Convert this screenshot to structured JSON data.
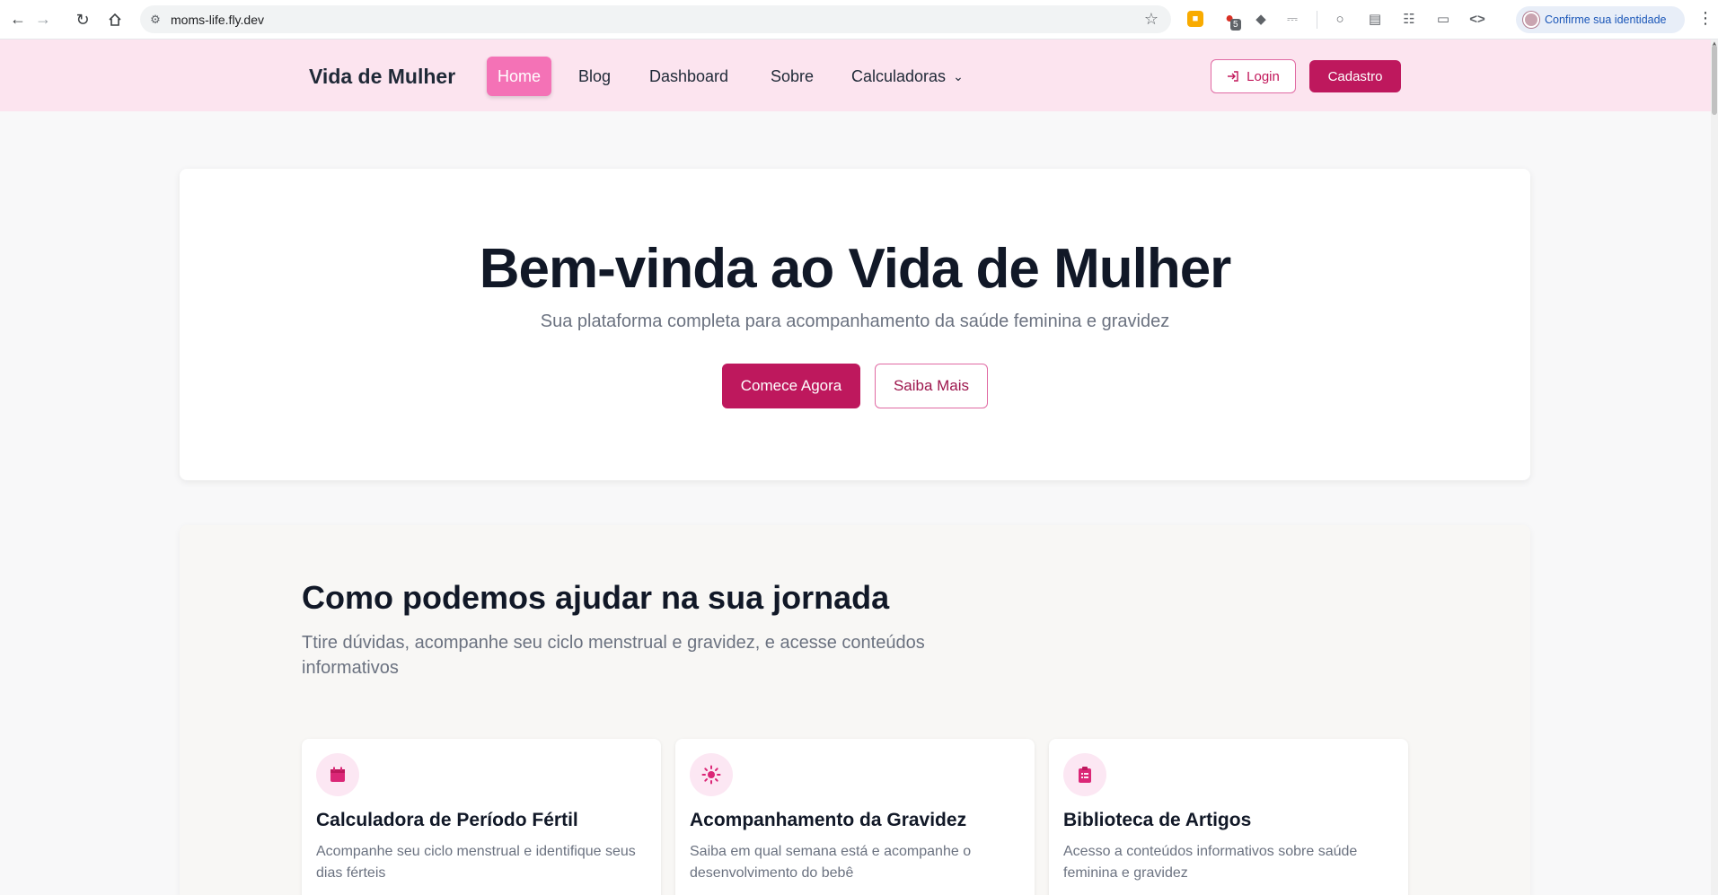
{
  "browser": {
    "url": "moms-life.fly.dev",
    "profile_label": "Confirme sua identidade",
    "extension_badge": "5"
  },
  "navbar": {
    "brand": "Vida de Mulher",
    "links": [
      {
        "label": "Home",
        "active": true
      },
      {
        "label": "Blog"
      },
      {
        "label": "Dashboard"
      },
      {
        "label": "Sobre"
      },
      {
        "label": "Calculadoras"
      }
    ],
    "login_label": "Login",
    "cadastro_label": "Cadastro"
  },
  "hero": {
    "title": "Bem-vinda ao Vida de Mulher",
    "subtitle": "Sua plataforma completa para acompanhamento da saúde feminina e gravidez",
    "primary_button": "Comece Agora",
    "secondary_button": "Saiba Mais"
  },
  "features": {
    "title": "Como podemos ajudar na sua jornada",
    "subtitle": "Ttire dúvidas, acompanhe seu ciclo menstrual e gravidez, e acesse conteúdos informativos",
    "cards": [
      {
        "icon": "calendar-icon",
        "title": "Calculadora de Período Fértil",
        "description": "Acompanhe seu ciclo menstrual e identifique seus dias férteis"
      },
      {
        "icon": "sun-icon",
        "title": "Acompanhamento da Gravidez",
        "description": "Saiba em qual semana está e acompanhe o desenvolvimento do bebê"
      },
      {
        "icon": "clipboard-icon",
        "title": "Biblioteca de Artigos",
        "description": "Acesso a conteúdos informativos sobre saúde feminina e gravidez"
      }
    ]
  },
  "colors": {
    "accent": "#be185d",
    "nav_bg": "#fce4ef",
    "active_link": "#f472b6"
  }
}
